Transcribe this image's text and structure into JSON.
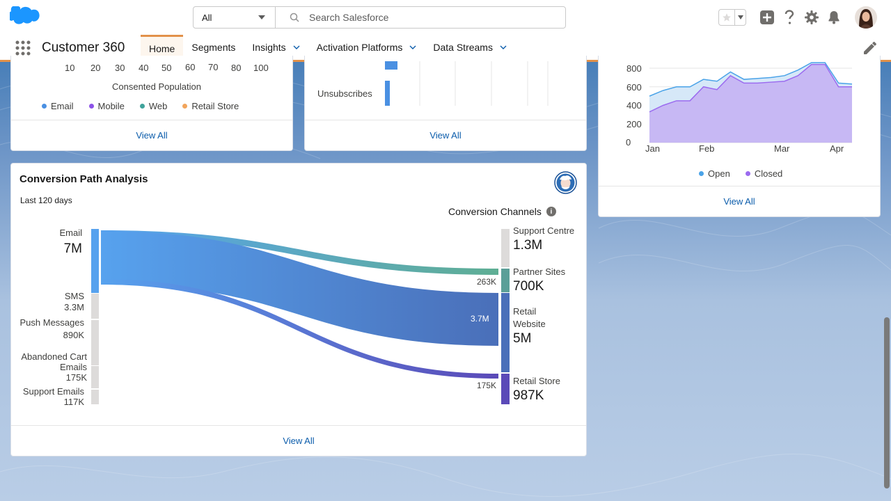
{
  "header": {
    "search_scope": "All",
    "search_placeholder": "Search Salesforce"
  },
  "nav": {
    "app_name": "Customer 360",
    "tabs": [
      {
        "label": "Home",
        "active": true
      },
      {
        "label": "Segments"
      },
      {
        "label": "Insights",
        "dropdown": true
      },
      {
        "label": "Activation Platforms",
        "dropdown": true
      },
      {
        "label": "Data Streams",
        "dropdown": true
      }
    ]
  },
  "consent_card": {
    "x_ticks": [
      "10",
      "20",
      "30",
      "40",
      "50",
      "60",
      "70",
      "80",
      "100"
    ],
    "x_label": "Consented Population",
    "legend": [
      {
        "label": "Email",
        "color": "#4a90e2"
      },
      {
        "label": "Mobile",
        "color": "#8c52e8"
      },
      {
        "label": "Web",
        "color": "#3fa39b"
      },
      {
        "label": "Retail Store",
        "color": "#f2a55c"
      }
    ],
    "view_all": "View All"
  },
  "engagement_card": {
    "row_label": "Unsubscribes",
    "view_all": "View All"
  },
  "cases_card": {
    "view_all": "View All",
    "chart_data": {
      "type": "area",
      "y_ticks": [
        "800",
        "600",
        "400",
        "200",
        "0"
      ],
      "x_ticks": [
        "Jan",
        "Feb",
        "Mar",
        "Apr"
      ],
      "ylim": [
        0,
        800
      ],
      "series": [
        {
          "name": "Open",
          "color": "#4aa3e8",
          "values": [
            500,
            560,
            600,
            600,
            680,
            660,
            760,
            680,
            690,
            700,
            720,
            780,
            860,
            860,
            640,
            630
          ]
        },
        {
          "name": "Closed",
          "color": "#9b6bef",
          "values": [
            330,
            400,
            450,
            450,
            600,
            570,
            720,
            640,
            640,
            650,
            660,
            720,
            840,
            840,
            600,
            600
          ]
        }
      ]
    }
  },
  "conversion": {
    "title": "Conversion Path Analysis",
    "subtitle": "Last 120 days",
    "channels_label": "Conversion Channels",
    "sources": [
      {
        "label": "Email",
        "value": "7M"
      },
      {
        "label": "SMS",
        "value": "3.3M"
      },
      {
        "label": "Push Messages",
        "value": "890K"
      },
      {
        "label": "Abandoned Cart Emails",
        "value": "175K"
      },
      {
        "label": "Support Emails",
        "value": "117K"
      }
    ],
    "targets": [
      {
        "label": "Support Centre",
        "value": "1.3M"
      },
      {
        "label": "Partner Sites",
        "value": "700K"
      },
      {
        "label": "Retail Website",
        "value": "5M"
      },
      {
        "label": "Retail Store",
        "value": "987K"
      }
    ],
    "flows": [
      {
        "from": "Email",
        "to": "Partner Sites",
        "value": "263K"
      },
      {
        "from": "Email",
        "to": "Retail Website",
        "value": "3.7M"
      },
      {
        "from": "Email",
        "to": "Retail Store",
        "value": "175K"
      }
    ],
    "view_all": "View All"
  }
}
